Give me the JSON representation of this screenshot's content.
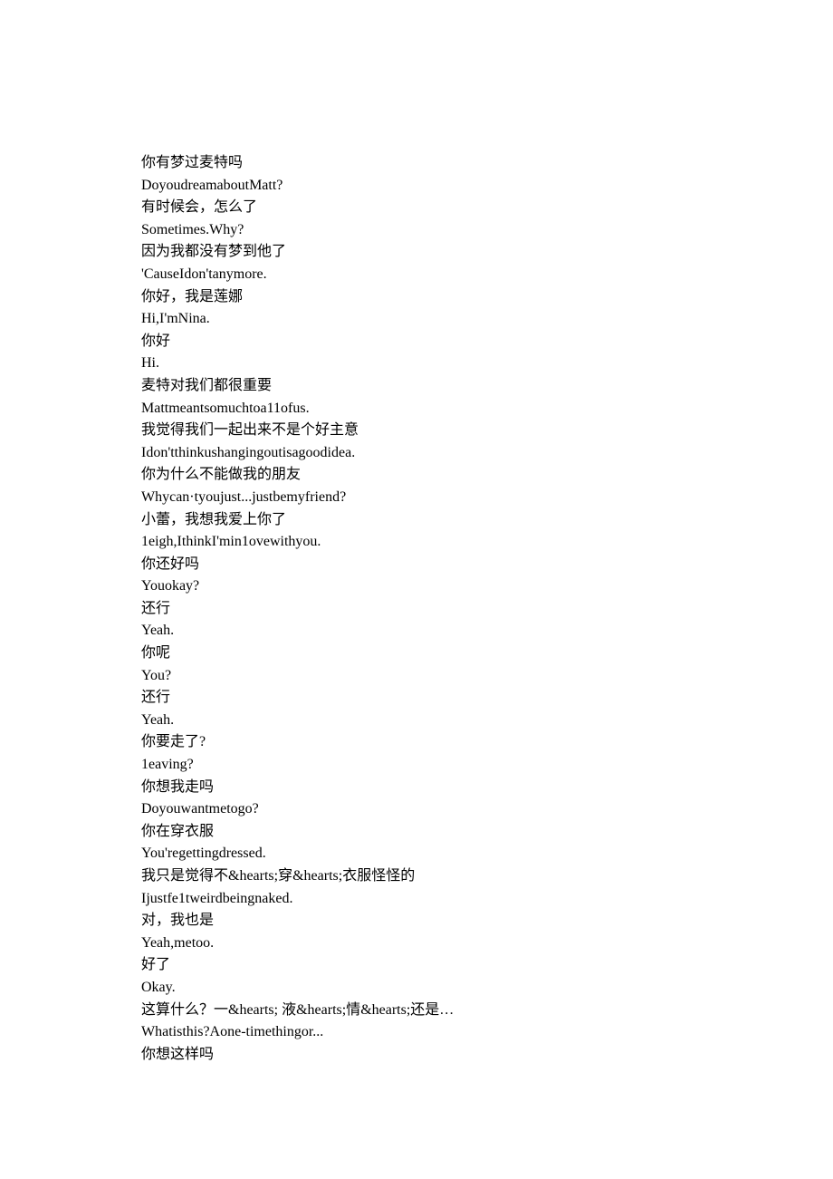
{
  "lines": [
    "你有梦过麦特吗",
    "DoyoudreamaboutMatt?",
    "有时候会，怎么了",
    "Sometimes.Why?",
    "因为我都没有梦到他了",
    "'CauseIdon'tanymore.",
    "你好，我是莲娜",
    "Hi,I'mNina.",
    "你好",
    "Hi.",
    "麦特对我们都很重要",
    "Mattmeantsomuchtoa11ofus.",
    "我觉得我们一起出来不是个好主意",
    "Idon'tthinkushangingoutisagoodidea.",
    "你为什么不能做我的朋友",
    "Whycan·tyoujust...justbemyfriend?",
    "小蕾，我想我爱上你了",
    "1eigh,IthinkI'min1ovewithyou.",
    "你还好吗",
    "Youokay?",
    "还行",
    "Yeah.",
    "你呢",
    "You?",
    "还行",
    "Yeah.",
    "你要走了?",
    "1eaving?",
    "你想我走吗",
    "Doyouwantmetogo?",
    "你在穿衣服",
    "You'regettingdressed.",
    "我只是觉得不&hearts;穿&hearts;衣服怪怪的",
    "Ijustfe1tweirdbeingnaked.",
    "对，我也是",
    "Yeah,metoo.",
    "好了",
    "Okay.",
    "这算什么？一&hearts; 液&hearts;情&hearts;还是…",
    "Whatisthis?Aone-timethingor...",
    "你想这样吗"
  ]
}
